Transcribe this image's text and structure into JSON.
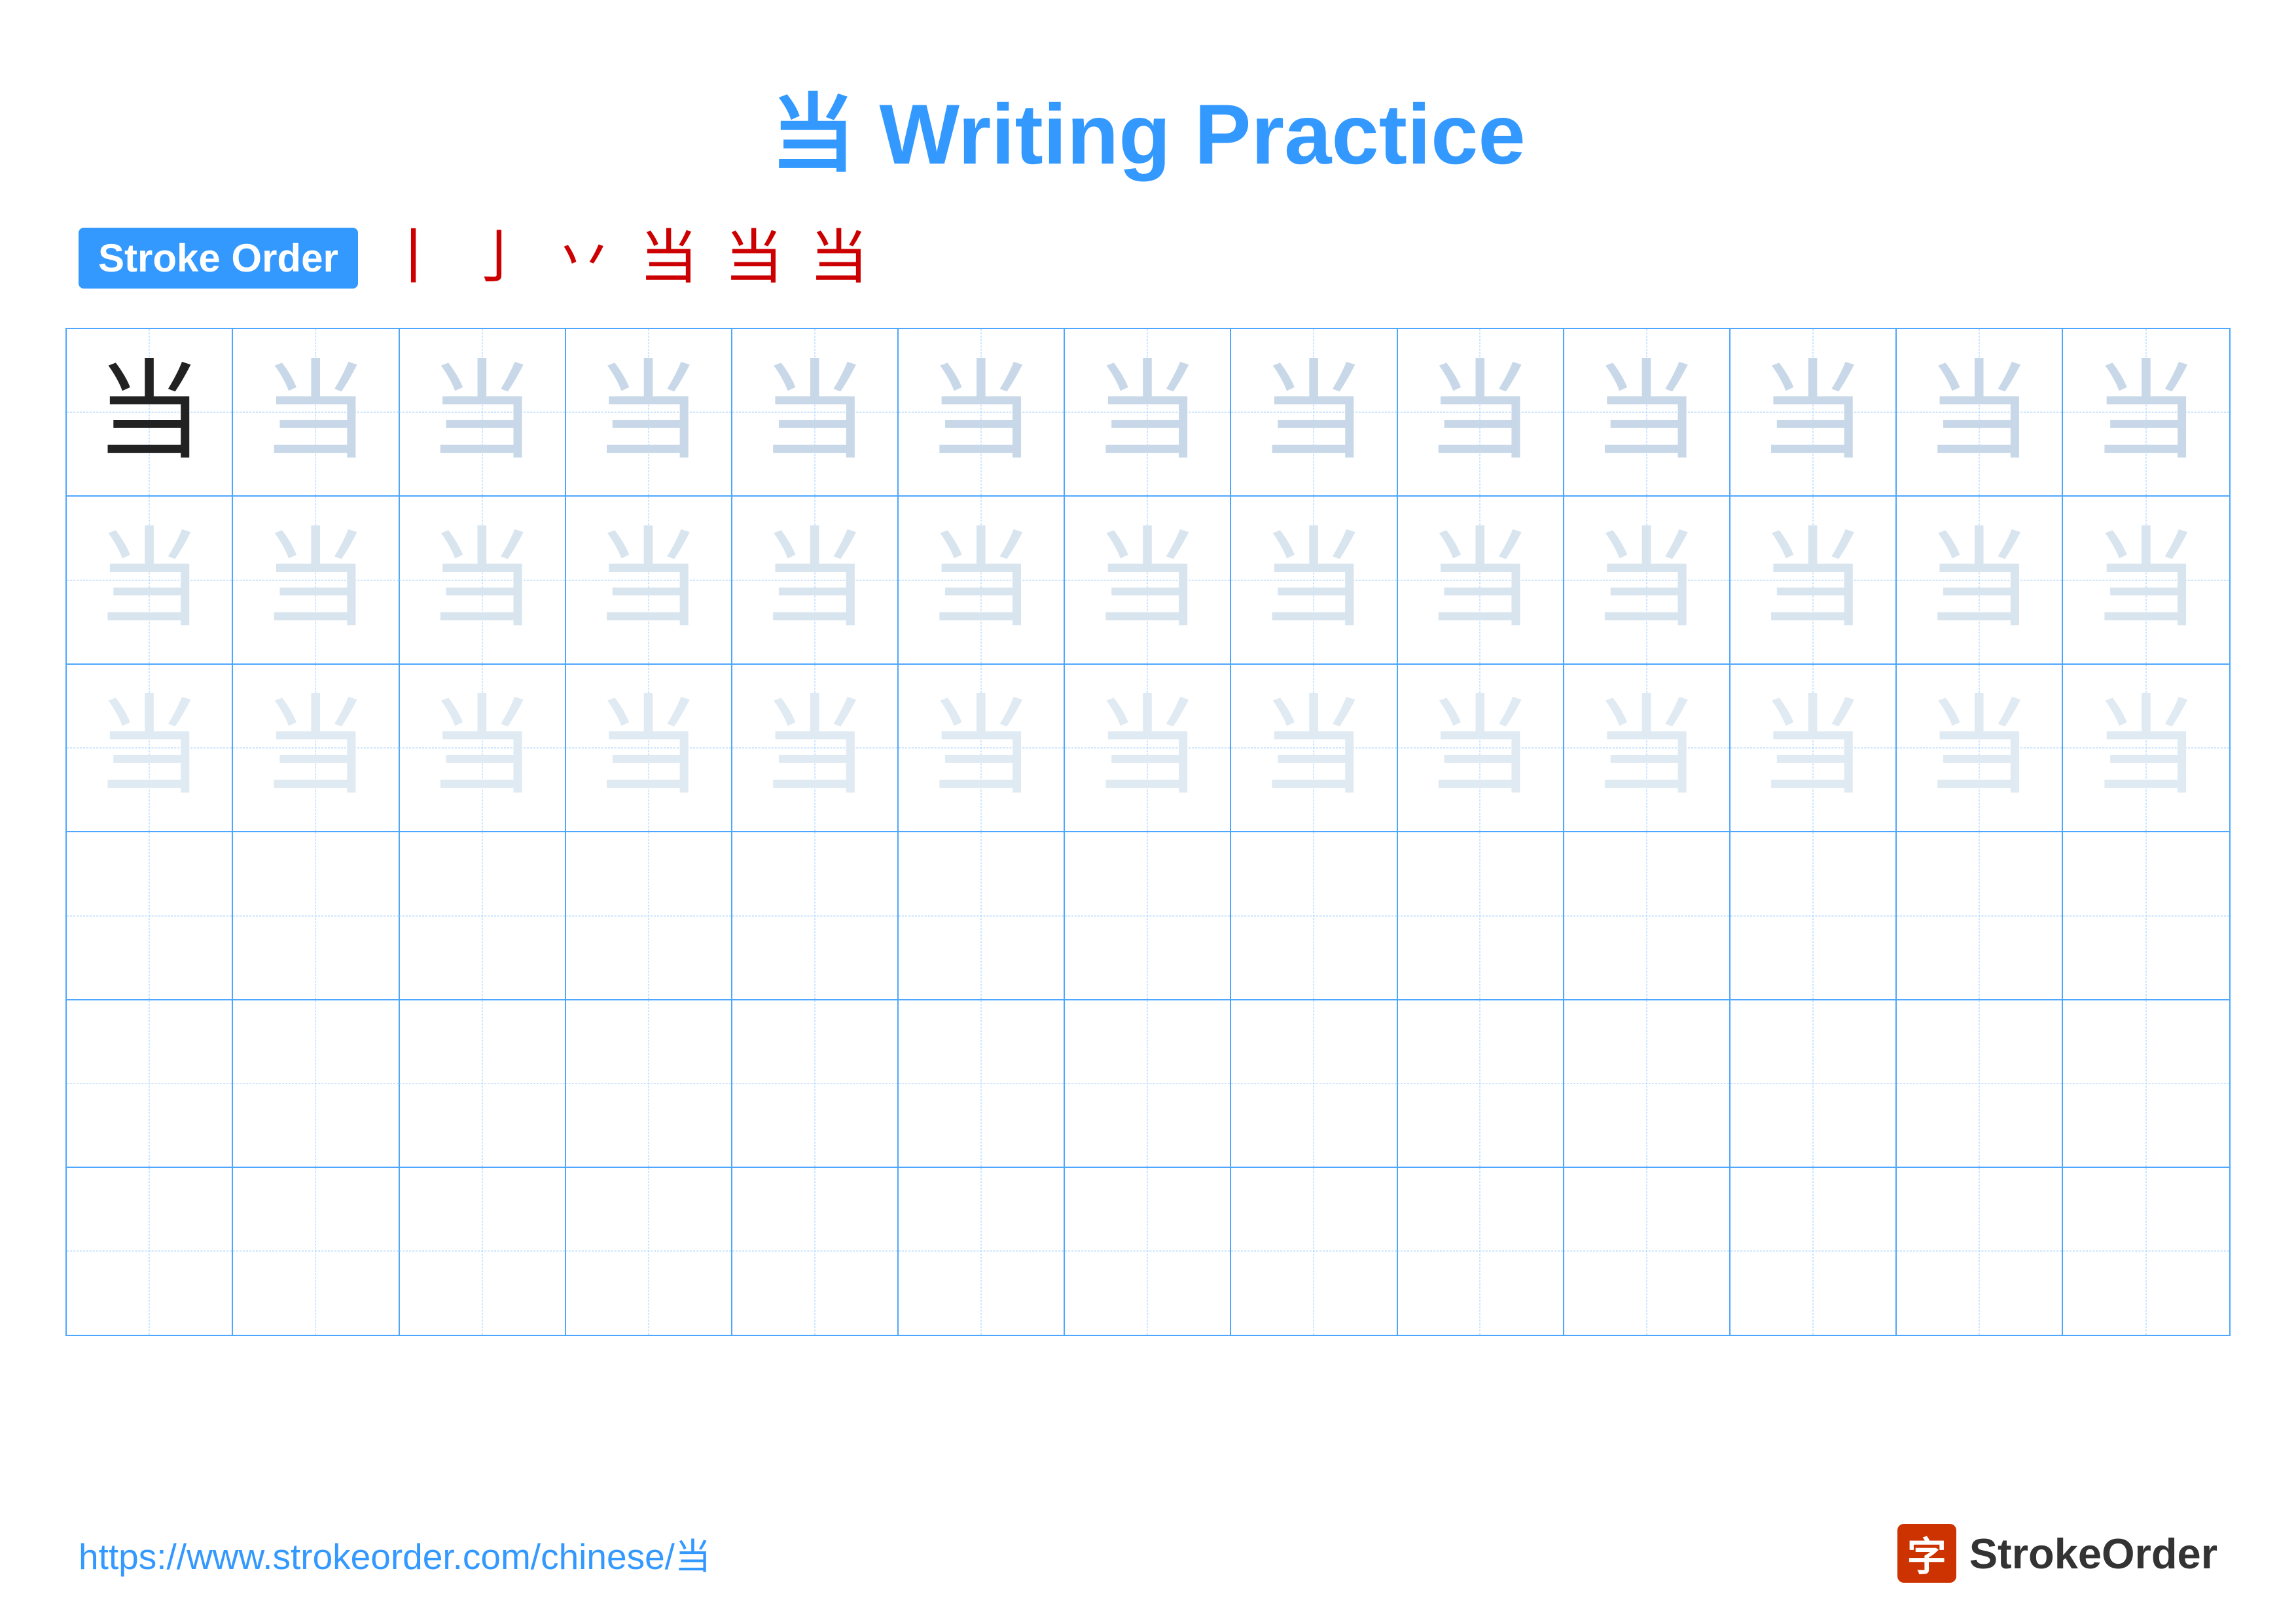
{
  "title": {
    "char": "当",
    "text": "Writing Practice"
  },
  "stroke_order": {
    "badge_label": "Stroke Order",
    "steps": [
      "丨",
      "亅",
      "丷",
      "当",
      "当",
      "当"
    ]
  },
  "grid": {
    "rows": 6,
    "cols": 13,
    "character": "当",
    "row_configs": [
      {
        "type": "dark_then_light1"
      },
      {
        "type": "light2"
      },
      {
        "type": "light3"
      },
      {
        "type": "empty"
      },
      {
        "type": "empty"
      },
      {
        "type": "empty"
      }
    ]
  },
  "footer": {
    "url": "https://www.strokeorder.com/chinese/当",
    "logo_char": "字",
    "logo_text": "StrokeOrder"
  }
}
